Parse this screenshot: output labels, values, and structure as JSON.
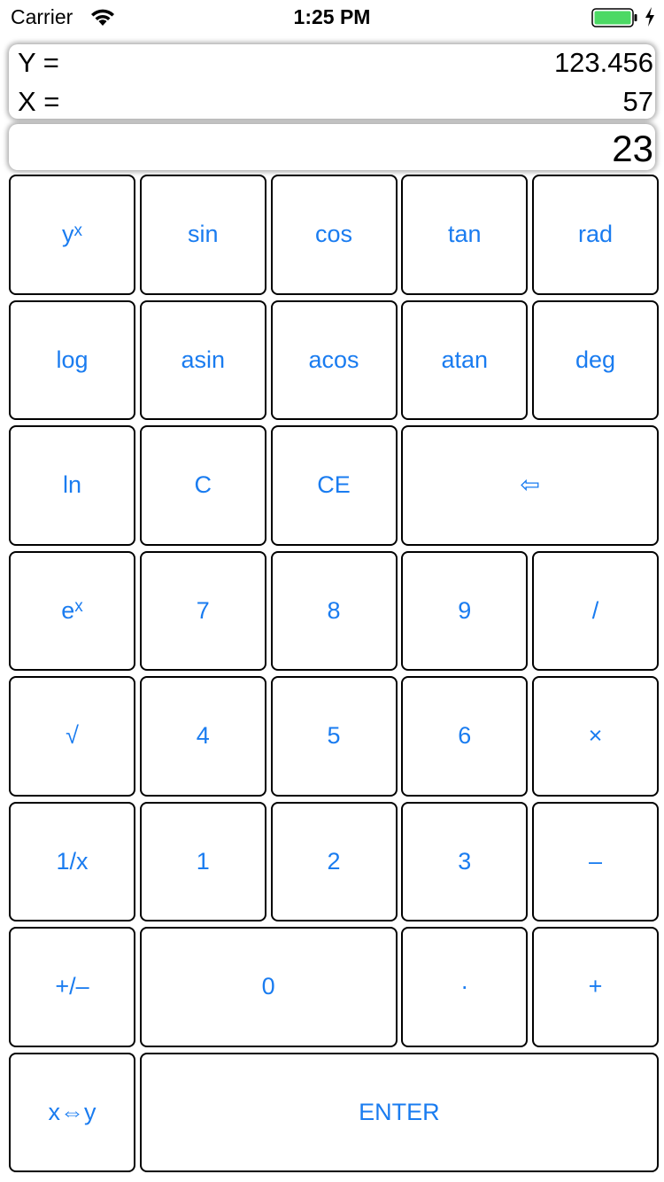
{
  "status_bar": {
    "carrier": "Carrier",
    "time": "1:25 PM",
    "icons": [
      "wifi-icon",
      "battery-icon",
      "charging-bolt-icon"
    ],
    "battery_color": "#4cd964"
  },
  "display": {
    "y_label": "Y =",
    "y_value": "123.456",
    "x_label": "X =",
    "x_value": "57",
    "entry_value": "23"
  },
  "accent_color": "#1a7cf0",
  "keys": {
    "pow_base": "y",
    "pow_exp": "x",
    "sin": "sin",
    "cos": "cos",
    "tan": "tan",
    "rad": "rad",
    "log": "log",
    "asin": "asin",
    "acos": "acos",
    "atan": "atan",
    "deg": "deg",
    "ln": "ln",
    "clear": "C",
    "clear_entry": "CE",
    "backspace": "⇦",
    "exp_base": "e",
    "exp_exp": "x",
    "seven": "7",
    "eight": "8",
    "nine": "9",
    "divide": "/",
    "sqrt": "√",
    "four": "4",
    "five": "5",
    "six": "6",
    "multiply": "×",
    "reciprocal": "1/x",
    "one": "1",
    "two": "2",
    "three": "3",
    "minus": "–",
    "negate": "+/–",
    "zero": "0",
    "decimal": "·",
    "plus": "+",
    "swap": "x⇔y",
    "enter": "ENTER"
  }
}
